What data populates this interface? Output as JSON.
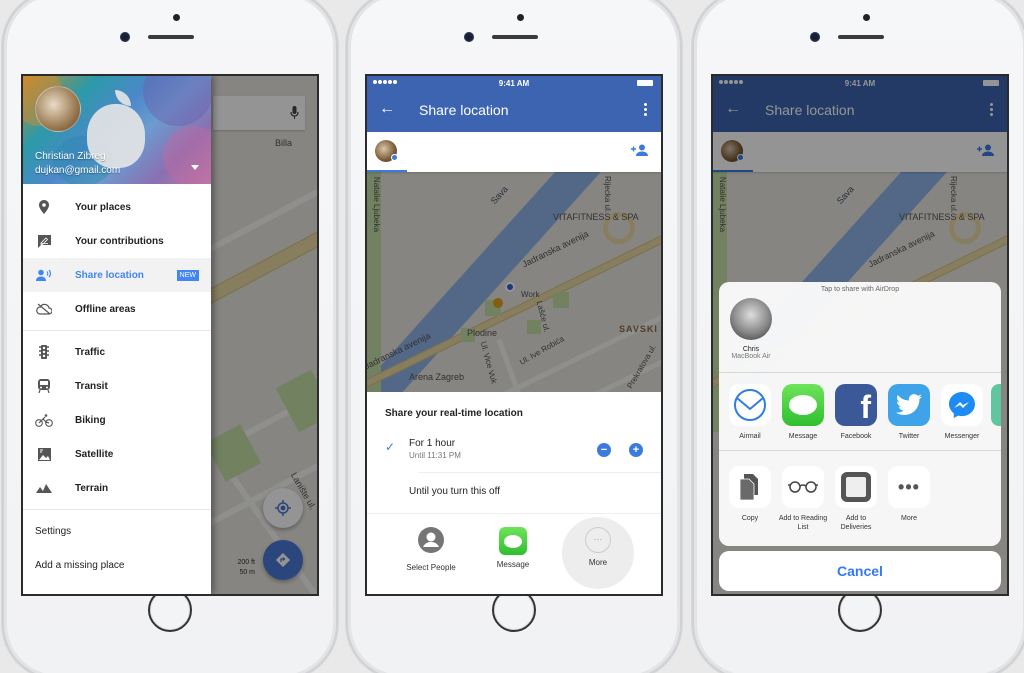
{
  "screen1": {
    "profile": {
      "name": "Christian Zibreg",
      "email": "dujkan@gmail.com"
    },
    "menu_primary": [
      {
        "label": "Your places",
        "icon": "place-pin-icon"
      },
      {
        "label": "Your contributions",
        "icon": "contributions-icon"
      },
      {
        "label": "Share location",
        "icon": "share-location-icon",
        "badge": "NEW",
        "active": true
      },
      {
        "label": "Offline areas",
        "icon": "offline-cloud-icon"
      }
    ],
    "menu_layers": [
      {
        "label": "Traffic",
        "icon": "traffic-light-icon"
      },
      {
        "label": "Transit",
        "icon": "transit-train-icon"
      },
      {
        "label": "Biking",
        "icon": "bike-icon"
      },
      {
        "label": "Satellite",
        "icon": "satellite-image-icon"
      },
      {
        "label": "Terrain",
        "icon": "terrain-mountain-icon"
      }
    ],
    "menu_footer": [
      {
        "label": "Settings"
      },
      {
        "label": "Add a missing place"
      }
    ],
    "map_labels": {
      "billa": "Billa",
      "lanište": "Lanište ul."
    },
    "scale": {
      "ft": "200 ft",
      "m": "50 m"
    }
  },
  "status": {
    "time": "9:41 AM"
  },
  "appbar": {
    "title": "Share location"
  },
  "map2": {
    "labels": {
      "river": "Sava",
      "gym": "VITAFITNESS & SPA",
      "avenue1": "Jadranska avenija",
      "avenue2": "Jadranska avenija",
      "work": "Work",
      "store": "Plodine",
      "district": "SAVSKI",
      "arena": "Arena Zagreb",
      "street1": "Ul. Ive Robića",
      "street2": "Ul. Vice Vuk",
      "street3": "Lašće ul.",
      "street4": "Prekratova ul.",
      "street5": "Rijecka ul.",
      "street6": "Natalie Ljubeka"
    }
  },
  "screen2": {
    "sheet_title": "Share your real-time location",
    "option1": {
      "label": "For 1 hour",
      "sub": "Until 11:31 PM",
      "minus": "−",
      "plus": "+"
    },
    "option2": {
      "label": "Until you turn this off"
    },
    "targets": [
      {
        "label": "Select People"
      },
      {
        "label": "Message"
      },
      {
        "label": "More"
      }
    ]
  },
  "screen3": {
    "airdrop_hint": "Tap to share with AirDrop",
    "airdrop_person": {
      "name": "Chris",
      "device": "MacBook Air"
    },
    "apps": [
      {
        "label": "Airmail",
        "color": "#ffffff"
      },
      {
        "label": "Message",
        "color": "#4cd964"
      },
      {
        "label": "Facebook",
        "color": "#3b5998"
      },
      {
        "label": "Twitter",
        "color": "#1da1f2"
      },
      {
        "label": "Messenger",
        "color": "#ffffff"
      }
    ],
    "actions": [
      {
        "label": "Copy"
      },
      {
        "label": "Add to Reading List"
      },
      {
        "label": "Add to Deliveries"
      },
      {
        "label": "More"
      }
    ],
    "cancel": "Cancel"
  }
}
